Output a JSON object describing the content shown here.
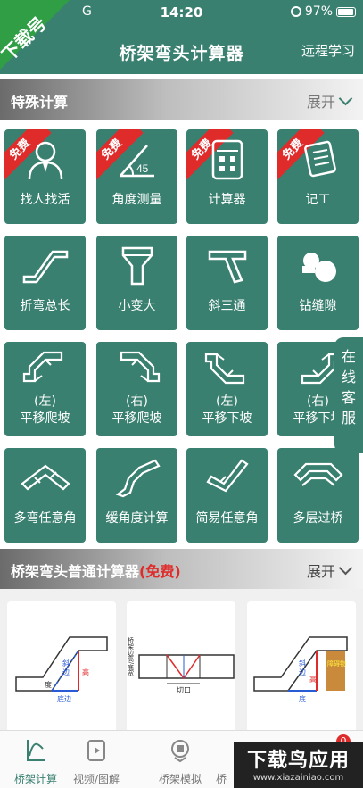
{
  "status": {
    "carrier": "G",
    "time": "14:20",
    "battery": "97%"
  },
  "header": {
    "title": "桥架弯头计算器",
    "remote": "远程学习"
  },
  "watermark": {
    "badge": "下载号",
    "bottom_main": "下载鸟应用",
    "bottom_url": "www.xiazainiao.com"
  },
  "special": {
    "title": "特殊计算",
    "expand": "展开",
    "tiles": [
      {
        "label": "找人找活",
        "icon": "person-icon",
        "ribbon": "免费"
      },
      {
        "label": "角度测量",
        "icon": "angle-icon",
        "ribbon": "免费",
        "angle": "45"
      },
      {
        "label": "计算器",
        "icon": "calculator-icon",
        "ribbon": "免费"
      },
      {
        "label": "记工",
        "icon": "notebook-icon",
        "ribbon": "免费"
      },
      {
        "label": "折弯总长",
        "icon": "bend-length-icon"
      },
      {
        "label": "小变大",
        "icon": "reducer-icon"
      },
      {
        "label": "斜三通",
        "icon": "tee-icon"
      },
      {
        "label": "钻缝隙",
        "icon": "gap-icon"
      },
      {
        "label1": "(左)",
        "label2": "平移爬坡",
        "icon": "shift-climb-left-icon"
      },
      {
        "label1": "(右)",
        "label2": "平移爬坡",
        "icon": "shift-climb-right-icon"
      },
      {
        "label1": "(左)",
        "label2": "平移下坡",
        "icon": "shift-down-left-icon"
      },
      {
        "label1": "(右)",
        "label2": "平移下坡",
        "icon": "shift-down-right-icon"
      },
      {
        "label": "多弯任意角",
        "icon": "multi-bend-icon"
      },
      {
        "label": "缓角度计算",
        "icon": "gentle-angle-icon"
      },
      {
        "label": "简易任意角",
        "icon": "simple-angle-icon"
      },
      {
        "label": "多层过桥",
        "icon": "multi-bridge-icon"
      }
    ]
  },
  "normal": {
    "title": "桥架弯头普通计算器",
    "free": "(免费)",
    "expand": "展开"
  },
  "cards": [
    {
      "labels": [
        "斜",
        "边",
        "高",
        "底边",
        "度"
      ]
    },
    {
      "labels": [
        "桥架边高/底宽",
        "切口"
      ]
    },
    {
      "labels": [
        "斜",
        "边",
        "障碍物",
        "底",
        "高"
      ]
    }
  ],
  "customer_service": "在线客服",
  "nav": [
    {
      "label": "桥架计算",
      "icon": "chart-icon"
    },
    {
      "label": "视频/图解",
      "icon": "video-icon"
    },
    {
      "label": "桥架模拟",
      "icon": "simulate-icon"
    },
    {
      "label": "桥",
      "icon": "store-icon"
    }
  ],
  "badge_count": "0",
  "colors": {
    "primary": "#3a8070",
    "red": "#e02b2b"
  }
}
